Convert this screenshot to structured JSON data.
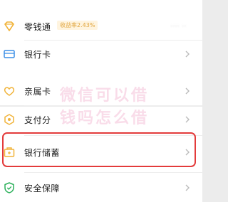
{
  "menu": {
    "items": [
      {
        "label": "零钱通",
        "badge": "收益率2.43%",
        "masked_value": "···· ··"
      },
      {
        "label": "银行卡"
      },
      {
        "label": "亲属卡"
      },
      {
        "label": "支付分"
      },
      {
        "label": "银行储蓄"
      },
      {
        "label": "安全保障"
      }
    ]
  },
  "watermark": {
    "line1": "微信可以借",
    "line2": "钱吗怎么借"
  },
  "colors": {
    "accent_yellow": "#f1b339",
    "accent_green": "#2bb05a",
    "highlight_red": "#e33b3b"
  }
}
